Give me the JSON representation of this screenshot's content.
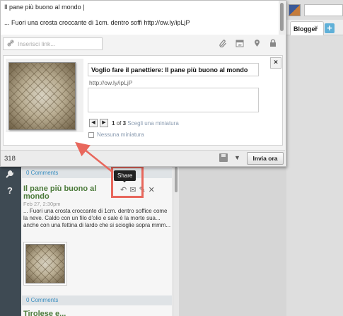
{
  "compose": {
    "text_line1": "Il pane più buono al mondo |",
    "text_line2": "... Fuori una crosta croccante di 1cm. dentro soffi http://ow.ly/ipLjP",
    "link_placeholder": "Inserisci link...",
    "char_count": "318",
    "send_label": "Invia ora",
    "tool_icons": [
      "paperclip-icon",
      "calendar-icon",
      "location-pin-icon",
      "lock-icon"
    ],
    "calendar_day": "30"
  },
  "preview": {
    "title": "Voglio fare il panettiere: Il pane più buono al mondo",
    "url": "http://ow.ly/ipLjP",
    "description": "",
    "thumb_current": "1",
    "thumb_of": "of",
    "thumb_total": "3",
    "thumb_choose": "Scegli una miniatura",
    "no_thumb_label": "Nessuna miniatura",
    "close_label": "×",
    "prev_label": "◀",
    "next_label": "▶"
  },
  "background": {
    "tab_label": "Blogger",
    "tab_close": "×",
    "add_tab": "+",
    "help": "?",
    "comments_1": "0 Comments",
    "post_title": "Il pane più buono al mondo",
    "post_date": "Feb 27, 2:30pm",
    "post_body": "... Fuori una crosta croccante di 1cm. dentro soffice come la neve. Caldo con un filo d'olio e sale è la morte sua... anche con una fettina di lardo che si scioglie sopra mmm...",
    "comments_2": "0 Comments",
    "next_title": "Tirolese e...",
    "tooltip": "Share"
  },
  "colors": {
    "highlight": "#e8675c",
    "accent_link": "#3a8ec0",
    "post_title": "#4b7a3a"
  }
}
